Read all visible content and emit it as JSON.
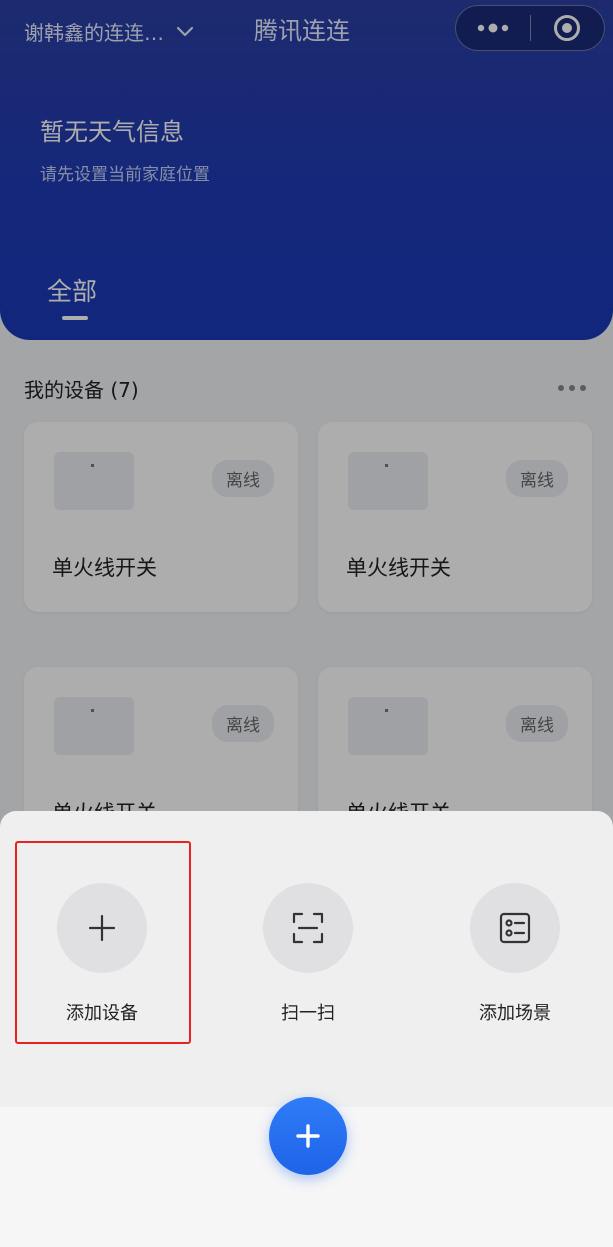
{
  "header": {
    "home_name": "谢韩鑫的连连…",
    "app_title": "腾讯连连",
    "weather_title": "暂无天气信息",
    "weather_subtitle": "请先设置当前家庭位置",
    "tab_all": "全部"
  },
  "capsule": {
    "more_icon": "more-dots-icon",
    "close_icon": "target-icon"
  },
  "devices_section": {
    "title": "我的设备 (7)",
    "cards": [
      {
        "name": "单火线开关",
        "status": "离线"
      },
      {
        "name": "单火线开关",
        "status": "离线"
      },
      {
        "name": "单火线开关",
        "status": "离线"
      },
      {
        "name": "单火线开关",
        "status": "离线"
      }
    ]
  },
  "sheet": {
    "actions": [
      {
        "label": "添加设备",
        "icon": "plus-icon"
      },
      {
        "label": "扫一扫",
        "icon": "scan-icon"
      },
      {
        "label": "添加场景",
        "icon": "scene-list-icon"
      }
    ]
  },
  "colors": {
    "header_blue": "#1f3ab5",
    "fab_blue": "#1e63e8",
    "highlight_red": "#e8221e"
  }
}
